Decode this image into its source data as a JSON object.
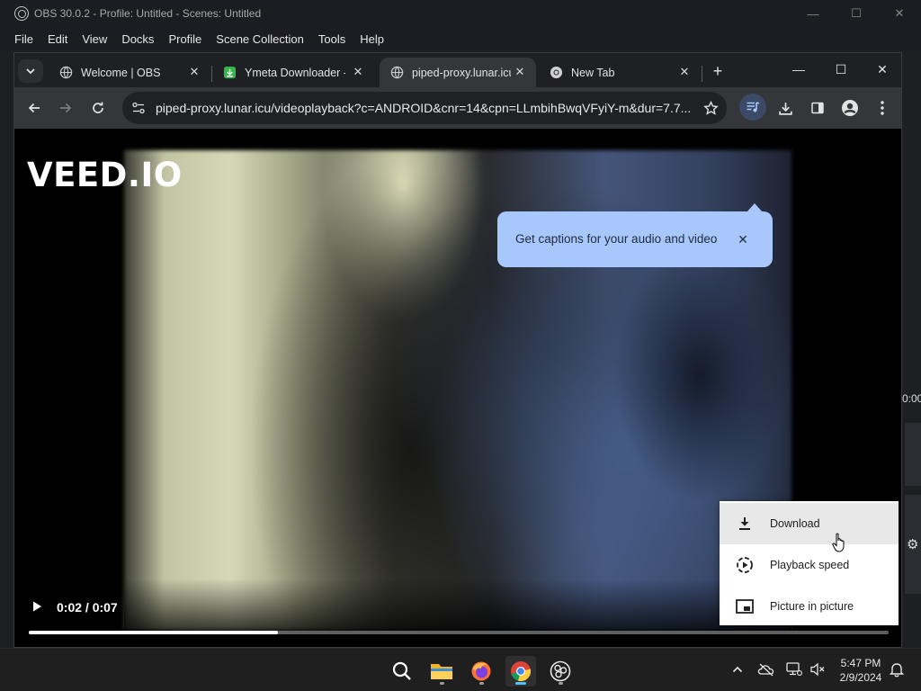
{
  "obs": {
    "title": "OBS 30.0.2 - Profile: Untitled - Scenes: Untitled",
    "menu": [
      "File",
      "Edit",
      "View",
      "Docks",
      "Profile",
      "Scene Collection",
      "Tools",
      "Help"
    ],
    "right_time": "0:00"
  },
  "chrome": {
    "tabs": [
      {
        "label": "Welcome | OBS",
        "active": false
      },
      {
        "label": "Ymeta Downloader -",
        "active": false
      },
      {
        "label": "piped-proxy.lunar.icu",
        "active": true
      },
      {
        "label": "New Tab",
        "active": false
      }
    ],
    "url": "piped-proxy.lunar.icu/videoplayback?c=ANDROID&cnr=14&cpn=LLmbihBwqVFyiY-m&dur=7.7..."
  },
  "video": {
    "watermark": "VEED.IO",
    "time": "0:02 / 0:07",
    "progress_fraction": 0.29
  },
  "caption_popup": {
    "text": "Get captions for your audio and video"
  },
  "context_menu": {
    "items": [
      {
        "label": "Download",
        "icon": "download-icon",
        "highlighted": true
      },
      {
        "label": "Playback speed",
        "icon": "playback-speed-icon",
        "highlighted": false
      },
      {
        "label": "Picture in picture",
        "icon": "picture-in-picture-icon",
        "highlighted": false
      }
    ]
  },
  "taskbar": {
    "time": "5:47 PM",
    "date": "2/9/2024"
  },
  "colors": {
    "caption_bubble": "#a8c7fa",
    "progress_accent": "#ffffff",
    "taskbar_indicator": "#4cc2ff"
  }
}
